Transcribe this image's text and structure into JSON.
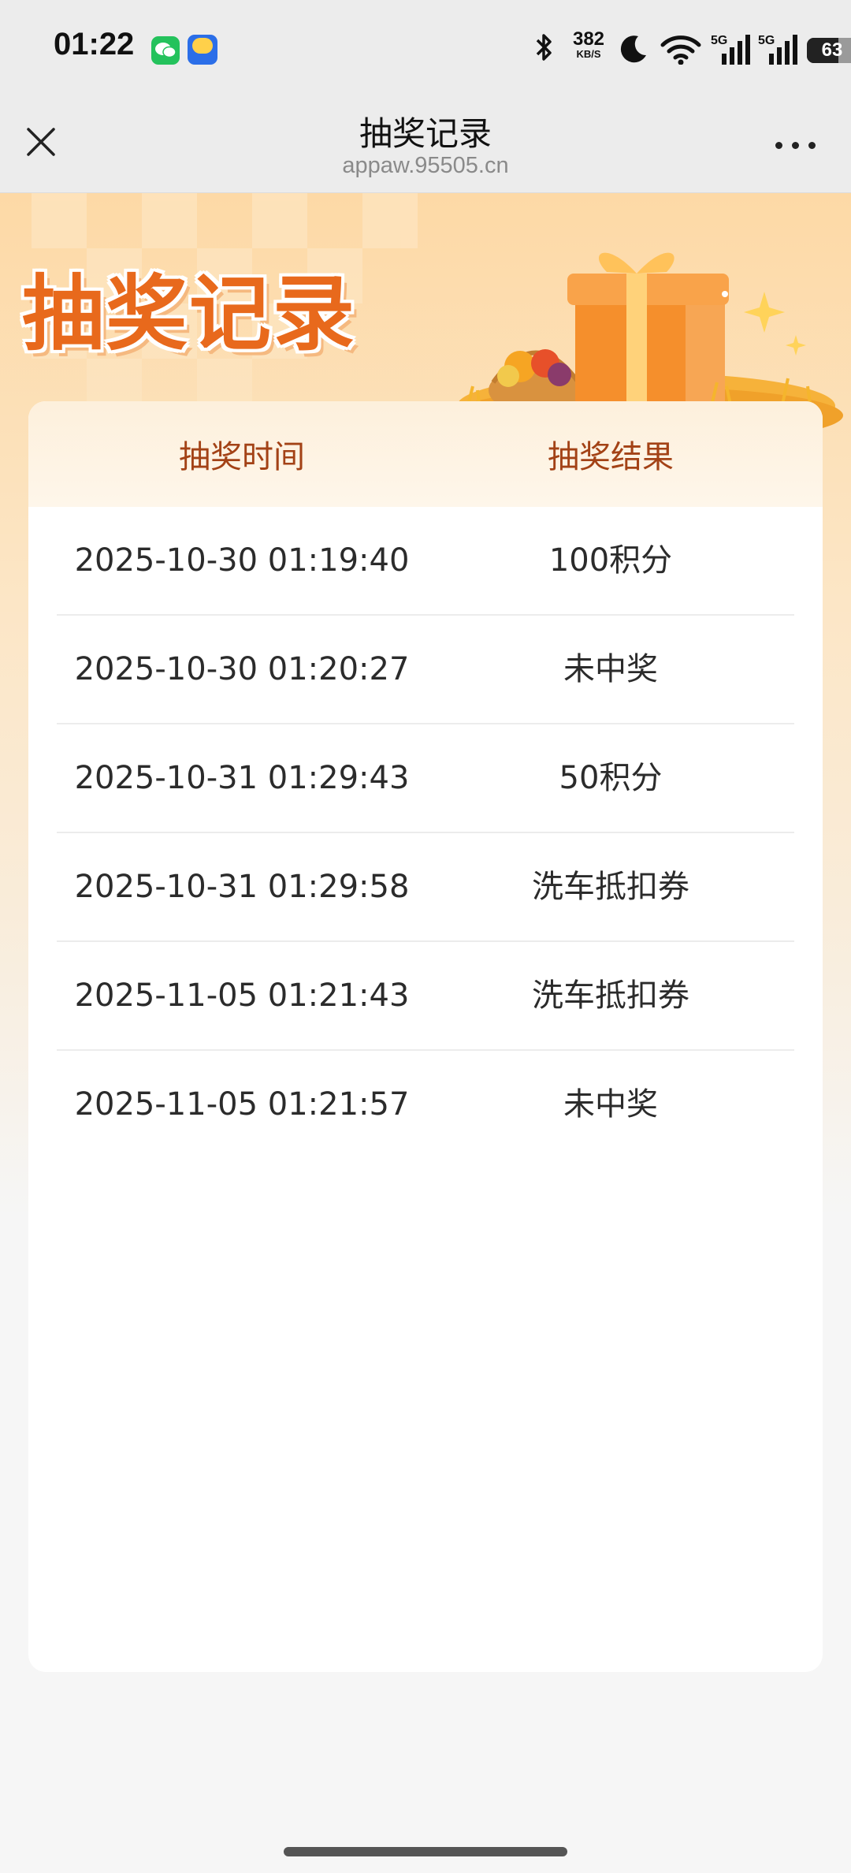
{
  "status_bar": {
    "time": "01:22",
    "net_speed": "382",
    "net_speed_unit": "KB/S",
    "signal_1": "5G",
    "signal_2": "5G",
    "battery": "63"
  },
  "nav": {
    "title": "抽奖记录",
    "subtitle": "appaw.95505.cn"
  },
  "banner": {
    "title": "抽奖记录"
  },
  "table": {
    "headers": [
      "抽奖时间",
      "抽奖结果"
    ],
    "rows": [
      {
        "time": "2025-10-30 01:19:40",
        "result": "100积分"
      },
      {
        "time": "2025-10-30 01:20:27",
        "result": "未中奖"
      },
      {
        "time": "2025-10-31 01:29:43",
        "result": "50积分"
      },
      {
        "time": "2025-10-31 01:29:58",
        "result": "洗车抵扣券"
      },
      {
        "time": "2025-11-05 01:21:43",
        "result": "洗车抵扣券"
      },
      {
        "time": "2025-11-05 01:21:57",
        "result": "未中奖"
      }
    ]
  },
  "colors": {
    "accent": "#e8691c",
    "header_text": "#a34216"
  }
}
